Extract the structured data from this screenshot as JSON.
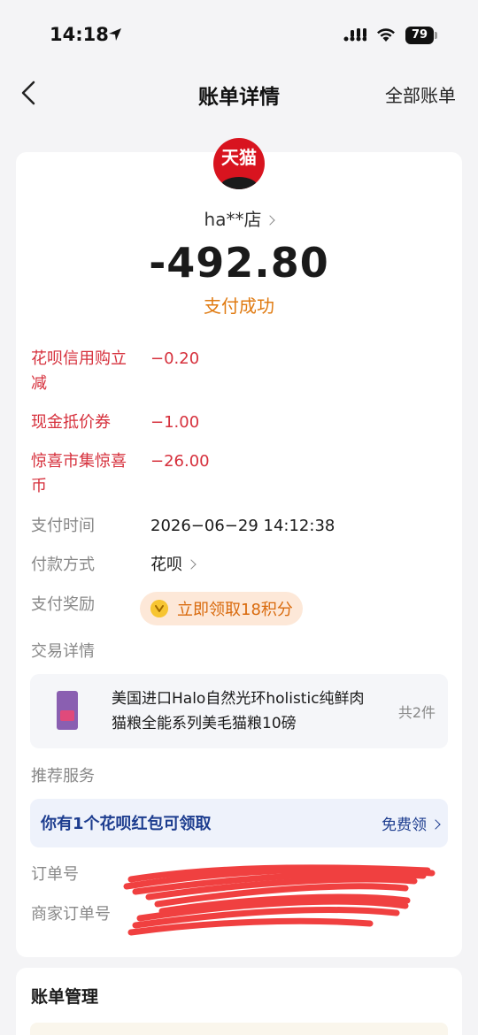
{
  "status_bar": {
    "time": "14:18",
    "battery": "79"
  },
  "nav": {
    "title": "账单详情",
    "right_link": "全部账单"
  },
  "merchant": {
    "logo_text": "天猫",
    "name": "ha**店"
  },
  "amount": "-492.80",
  "pay_status": "支付成功",
  "discounts": [
    {
      "label": "花呗信用购立减",
      "value": "−0.20"
    },
    {
      "label": "现金抵价券",
      "value": "−1.00"
    },
    {
      "label": "惊喜市集惊喜币",
      "value": "−26.00"
    }
  ],
  "details": {
    "pay_time_label": "支付时间",
    "pay_time": "2026−06−29 14:12:38",
    "method_label": "付款方式",
    "method": "花呗",
    "reward_label": "支付奖励",
    "reward": "立即领取18积分",
    "trade_label": "交易详情"
  },
  "product": {
    "name": "美国进口Halo自然光环holistic纯鲜肉猫粮全能系列美毛猫粮10磅",
    "count": "共2件"
  },
  "recommend": {
    "label": "推荐服务",
    "coupon_text": "你有1个花呗红包可领取",
    "coupon_action": "免费领"
  },
  "order": {
    "order_no_label": "订单号",
    "merchant_order_label": "商家订单号"
  },
  "management": {
    "title": "账单管理"
  },
  "colors": {
    "accent_red": "#d6303c",
    "status_orange": "#e07b12",
    "link_blue": "#1d3d8f",
    "tmall_red": "#d8141f"
  }
}
